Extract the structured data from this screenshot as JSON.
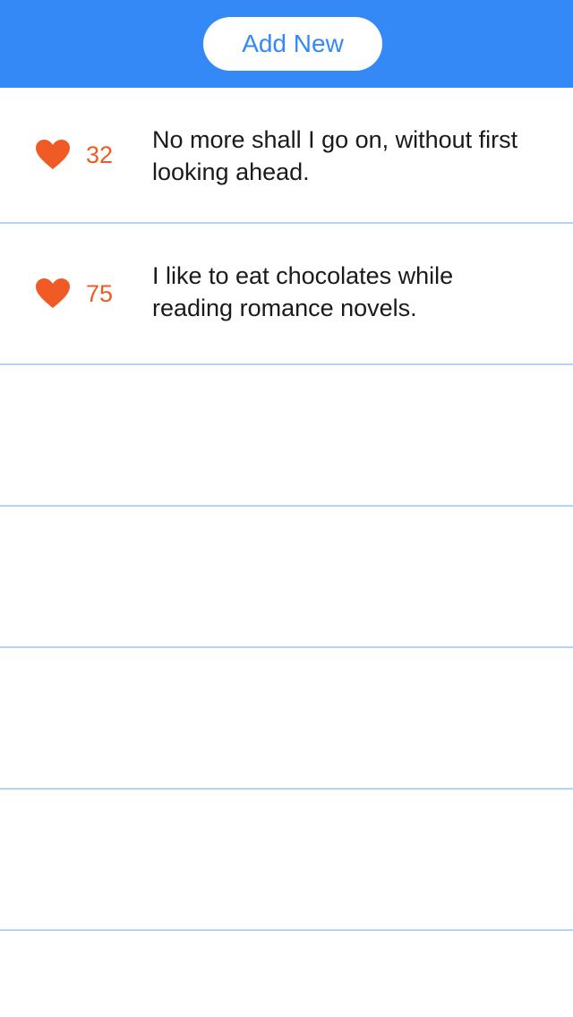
{
  "header": {
    "add_new_label": "Add New"
  },
  "colors": {
    "accent": "#3589f7",
    "like": "#f05a24",
    "divider": "#b7d3ef"
  },
  "posts": [
    {
      "likes": "32",
      "text": "No more shall I go on, without first looking ahead.",
      "icon": "heart-icon"
    },
    {
      "likes": "75",
      "text": "I like to eat chocolates while reading romance novels.",
      "icon": "heart-icon"
    }
  ]
}
